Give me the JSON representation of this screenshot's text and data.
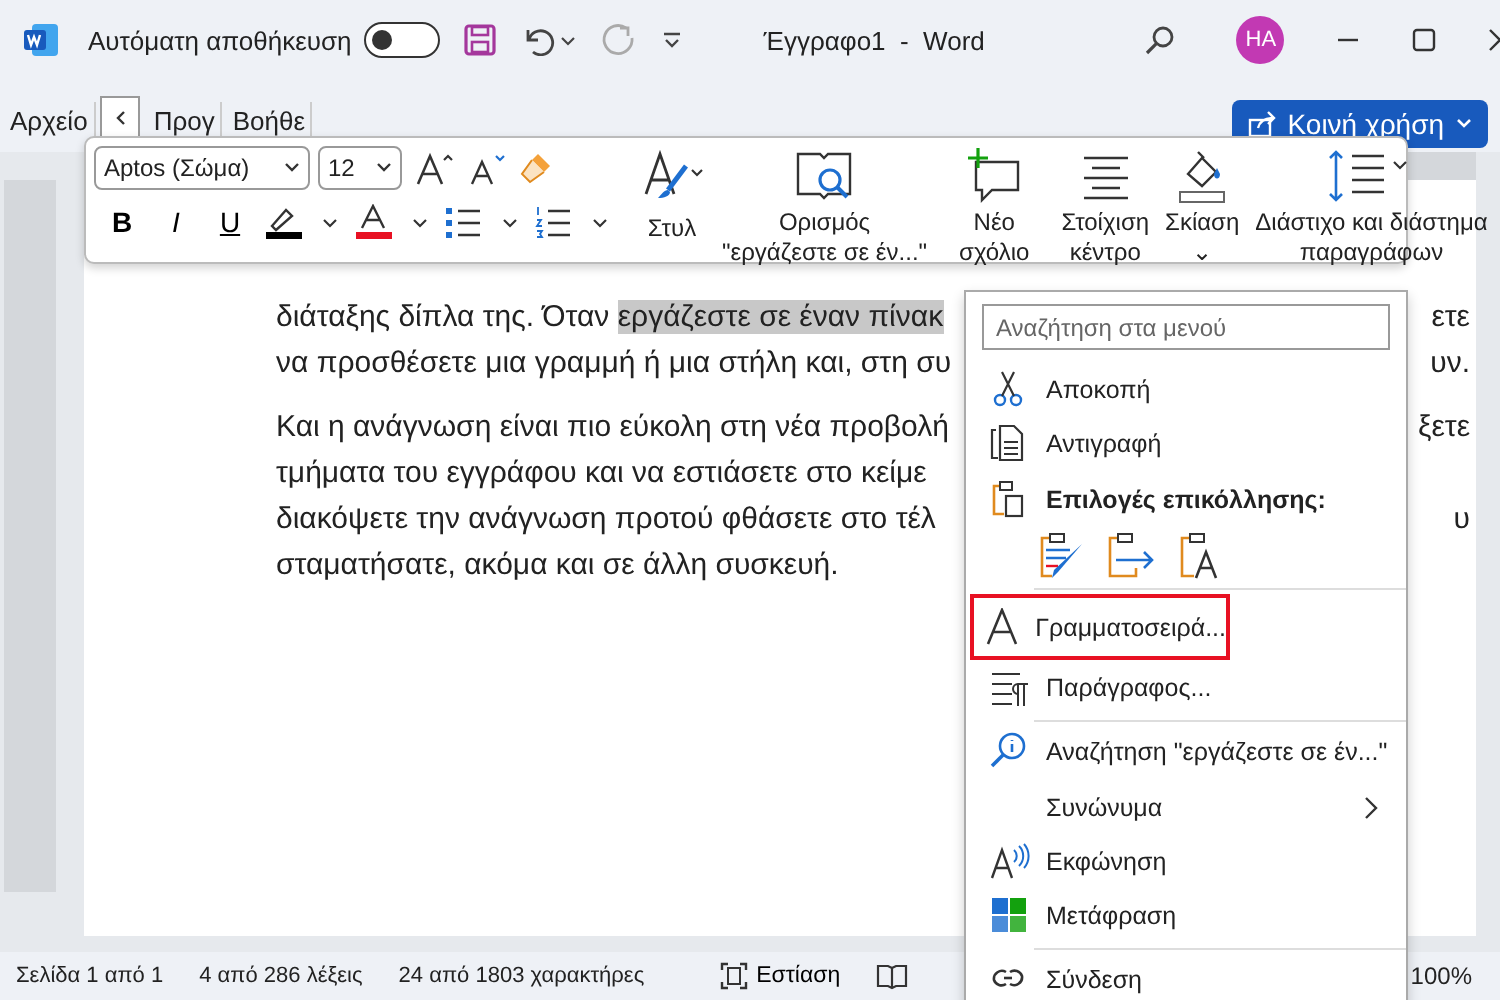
{
  "title_bar": {
    "autosave_label": "Αυτόματη αποθήκευση",
    "autosave_on": false,
    "title": "Έγγραφο1  -  Word",
    "avatar": "HA"
  },
  "ribbon_tabs": [
    {
      "label": "Αρχείο"
    },
    {
      "label": "Προγ"
    },
    {
      "label": "Βοήθε"
    }
  ],
  "share_button": "Κοινή χρήση",
  "mini_toolbar": {
    "font": "Aptos (Σώμα)",
    "size": "12",
    "format_buttons": [
      "B",
      "I",
      "U"
    ],
    "buttons": [
      {
        "lines": [
          "Στυλ"
        ]
      },
      {
        "lines": [
          "Ορισμός",
          "\"εργάζεστε σε έν...\""
        ]
      },
      {
        "lines": [
          "Νέο",
          "σχόλιο"
        ]
      },
      {
        "lines": [
          "Στοίχιση",
          "κέντρο"
        ]
      },
      {
        "lines": [
          "Σκίαση",
          "⌄"
        ]
      },
      {
        "lines": [
          "Διάστιχο και διάστημα",
          "παραγράφων"
        ]
      }
    ]
  },
  "document": {
    "paragraphs": [
      {
        "lines": [
          {
            "runs": [
              {
                "text": "διάταξης δίπλα της. Όταν ",
                "selected": false
              },
              {
                "text": "εργάζεστε σε έναν πίνακ",
                "selected": true
              }
            ],
            "right": "ετε"
          },
          {
            "runs": [
              {
                "text": "να προσθέσετε μια γραμμή ή μια στήλη και, στη συ",
                "selected": false
              }
            ],
            "right": "υν."
          }
        ]
      },
      {
        "lines": [
          {
            "runs": [
              {
                "text": "Και η ανάγνωση είναι πιο εύκολη στη νέα προβολή",
                "selected": false
              }
            ],
            "right": "ξετε"
          },
          {
            "runs": [
              {
                "text": "τμήματα του εγγράφου και να εστιάσετε στο κείμε",
                "selected": false
              }
            ]
          },
          {
            "runs": [
              {
                "text": "διακόψετε την ανάγνωση προτού φθάσετε στο τέλ",
                "selected": false
              }
            ],
            "right": "υ"
          },
          {
            "runs": [
              {
                "text": "σταματήσατε, ακόμα και σε άλλη συσκευή.",
                "selected": false
              }
            ]
          }
        ]
      }
    ]
  },
  "context_menu": {
    "search_placeholder": "Αναζήτηση στα μενού",
    "items": [
      {
        "kind": "command",
        "label": "Αποκοπή"
      },
      {
        "kind": "command",
        "label": "Αντιγραφή"
      },
      {
        "kind": "header",
        "label": "Επιλογές επικόλλησης:"
      },
      {
        "kind": "paste_options"
      },
      {
        "kind": "separator"
      },
      {
        "kind": "command",
        "label": "Γραμματοσειρά...",
        "boxed": true
      },
      {
        "kind": "command",
        "label": "Παράγραφος..."
      },
      {
        "kind": "separator"
      },
      {
        "kind": "command",
        "label": "Αναζήτηση \"εργάζεστε σε έν...\""
      },
      {
        "kind": "command",
        "label": "Συνώνυμα",
        "submenu": true
      },
      {
        "kind": "command",
        "label": "Εκφώνηση"
      },
      {
        "kind": "command",
        "label": "Μετάφραση"
      },
      {
        "kind": "separator"
      },
      {
        "kind": "command",
        "label": "Σύνδεση"
      }
    ]
  },
  "status_bar": {
    "items": [
      "Σελίδα 1 από 1",
      "4 από 286 λέξεις",
      "24 από 1803 χαρακτήρες"
    ],
    "focus": "Εστίαση",
    "zoom": "100%"
  }
}
